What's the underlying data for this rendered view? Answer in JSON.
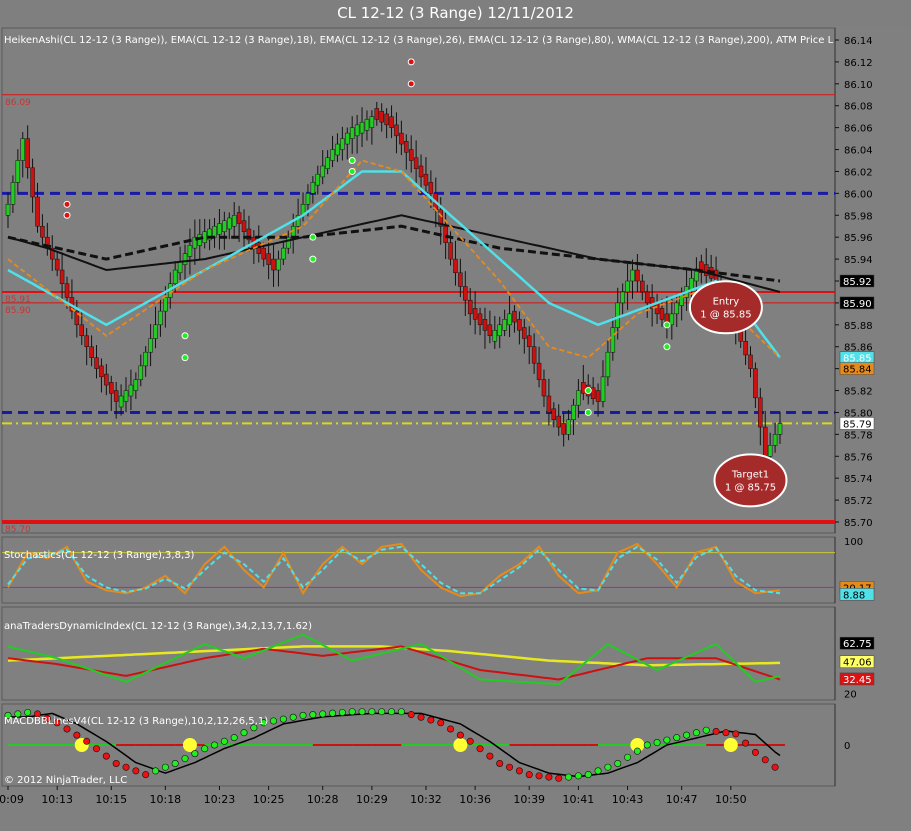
{
  "chart_title": "CL 12-12 (3 Range)  12/11/2012",
  "copyright": "© 2012 NinjaTrader, LLC",
  "colors": {
    "background": "#808080",
    "bull_candle": "#22cc22",
    "bear_candle": "#cc1111",
    "ema18": "#e88a1a",
    "ema26": "#4fe0e8",
    "ema80": "#111111",
    "wma200": "#111111",
    "blue_level": "#1a1aa8",
    "red_level": "#dd1111",
    "yellow_level": "#d8d820"
  },
  "chart_data": [
    {
      "type": "candlestick",
      "name": "price",
      "legend": "HeikenAshi(CL 12-12 (3 Range)), EMA(CL 12-12 (3 Range),18), EMA(CL 12-12 (3 Range),26), EMA(CL 12-12 (3 Range),80), WMA(CL 12-12 (3 Range),200), ATM Price L",
      "ylim": [
        85.69,
        86.15
      ],
      "y_ticks": [
        "86.14",
        "86.12",
        "86.10",
        "86.08",
        "86.06",
        "86.04",
        "86.02",
        "86.00",
        "85.98",
        "85.96",
        "85.94",
        "85.92",
        "85.90",
        "85.88",
        "85.86",
        "85.84",
        "85.82",
        "85.80",
        "85.78",
        "85.76",
        "85.74",
        "85.72",
        "85.70"
      ],
      "x_ticks": [
        "10:09",
        "10:13",
        "10:15",
        "10:18",
        "10:23",
        "10:25",
        "10:28",
        "10:29",
        "10:32",
        "10:36",
        "10:39",
        "10:41",
        "10:43",
        "10:47",
        "10:50"
      ],
      "close_keypoints": [
        [
          0,
          85.99
        ],
        [
          3,
          86.05
        ],
        [
          6,
          85.97
        ],
        [
          10,
          85.93
        ],
        [
          14,
          85.88
        ],
        [
          18,
          85.84
        ],
        [
          22,
          85.81
        ],
        [
          26,
          85.83
        ],
        [
          30,
          85.88
        ],
        [
          34,
          85.93
        ],
        [
          38,
          85.96
        ],
        [
          42,
          85.97
        ],
        [
          46,
          85.98
        ],
        [
          50,
          85.95
        ],
        [
          54,
          85.93
        ],
        [
          58,
          85.97
        ],
        [
          62,
          86.01
        ],
        [
          66,
          86.04
        ],
        [
          70,
          86.06
        ],
        [
          74,
          86.07
        ],
        [
          78,
          86.06
        ],
        [
          82,
          86.03
        ],
        [
          86,
          86.0
        ],
        [
          90,
          85.94
        ],
        [
          94,
          85.89
        ],
        [
          98,
          85.87
        ],
        [
          102,
          85.89
        ],
        [
          106,
          85.86
        ],
        [
          110,
          85.8
        ],
        [
          113,
          85.78
        ],
        [
          116,
          85.82
        ],
        [
          120,
          85.81
        ],
        [
          124,
          85.9
        ],
        [
          127,
          85.93
        ],
        [
          130,
          85.9
        ],
        [
          134,
          85.88
        ],
        [
          136,
          85.9
        ],
        [
          140,
          85.93
        ],
        [
          144,
          85.92
        ],
        [
          147,
          85.89
        ],
        [
          151,
          85.84
        ],
        [
          154,
          85.76
        ],
        [
          157,
          85.79
        ]
      ],
      "ema18": [
        [
          0,
          85.94
        ],
        [
          20,
          85.87
        ],
        [
          40,
          85.93
        ],
        [
          60,
          85.97
        ],
        [
          72,
          86.03
        ],
        [
          80,
          86.02
        ],
        [
          90,
          85.97
        ],
        [
          100,
          85.92
        ],
        [
          110,
          85.86
        ],
        [
          118,
          85.85
        ],
        [
          128,
          85.89
        ],
        [
          140,
          85.91
        ],
        [
          150,
          85.88
        ],
        [
          157,
          85.85
        ]
      ],
      "ema26": [
        [
          0,
          85.93
        ],
        [
          20,
          85.88
        ],
        [
          40,
          85.93
        ],
        [
          60,
          85.98
        ],
        [
          72,
          86.02
        ],
        [
          80,
          86.02
        ],
        [
          90,
          85.98
        ],
        [
          100,
          85.94
        ],
        [
          110,
          85.9
        ],
        [
          120,
          85.88
        ],
        [
          132,
          85.9
        ],
        [
          144,
          85.92
        ],
        [
          152,
          85.88
        ],
        [
          157,
          85.85
        ]
      ],
      "ema80": [
        [
          0,
          85.96
        ],
        [
          20,
          85.94
        ],
        [
          40,
          85.96
        ],
        [
          60,
          85.96
        ],
        [
          80,
          85.97
        ],
        [
          90,
          85.96
        ],
        [
          100,
          85.95
        ],
        [
          120,
          85.94
        ],
        [
          140,
          85.93
        ],
        [
          157,
          85.92
        ]
      ],
      "wma200": [
        [
          0,
          85.96
        ],
        [
          8,
          85.95
        ],
        [
          20,
          85.93
        ],
        [
          40,
          85.94
        ],
        [
          60,
          85.96
        ],
        [
          80,
          85.98
        ],
        [
          90,
          85.97
        ],
        [
          100,
          85.96
        ],
        [
          120,
          85.94
        ],
        [
          140,
          85.93
        ],
        [
          157,
          85.91
        ]
      ],
      "lines": [
        {
          "y": 86.09,
          "color": "#dd1111",
          "width": 1,
          "label": "86.09"
        },
        {
          "y": 86.0,
          "color": "#1a1aa8",
          "width": 3,
          "dash": "10,6"
        },
        {
          "y": 85.91,
          "color": "#dd1111",
          "width": 2,
          "label": "85.91"
        },
        {
          "y": 85.9,
          "color": "#dd1111",
          "width": 1,
          "label": "85.90"
        },
        {
          "y": 85.8,
          "color": "#1a1aa8",
          "width": 3,
          "dash": "10,6"
        },
        {
          "y": 85.79,
          "color": "#d8d820",
          "width": 2,
          "dash": "10,4,2,4"
        },
        {
          "y": 85.7,
          "color": "#dd1111",
          "width": 4,
          "label": "85.70"
        }
      ],
      "price_tags": [
        {
          "y": 85.92,
          "text": "85.92",
          "bg": "#000000",
          "fg": "#ffffff"
        },
        {
          "y": 85.9,
          "text": "85.90",
          "bg": "#000000",
          "fg": "#ffffff"
        },
        {
          "y": 85.85,
          "text": "85.85",
          "bg": "#4fe0e8",
          "fg": "#ffffff"
        },
        {
          "y": 85.84,
          "text": "85.84",
          "bg": "#e88a1a",
          "fg": "#000000"
        },
        {
          "y": 85.79,
          "text": "85.79",
          "bg": "#ffffff",
          "fg": "#000000"
        }
      ],
      "red_dots": [
        [
          12,
          85.99
        ],
        [
          12,
          85.98
        ],
        [
          82,
          86.12
        ],
        [
          82,
          86.1
        ]
      ],
      "green_dots": [
        [
          36,
          85.87
        ],
        [
          36,
          85.85
        ],
        [
          70,
          86.03
        ],
        [
          70,
          86.02
        ],
        [
          62,
          85.96
        ],
        [
          62,
          85.94
        ],
        [
          118,
          85.82
        ],
        [
          118,
          85.8
        ],
        [
          134,
          85.88
        ],
        [
          134,
          85.86
        ]
      ],
      "annotations": [
        {
          "x": 146,
          "y": 85.896,
          "line1": "Entry",
          "line2": "1 @ 85.85"
        },
        {
          "x": 151,
          "y": 85.738,
          "line1": "Target1",
          "line2": "1 @ 85.75"
        }
      ]
    },
    {
      "type": "line",
      "name": "stochastics",
      "legend": "Stochastics(CL 12-12 (3 Range),3,8,3)",
      "ylim": [
        0,
        100
      ],
      "y_ticks": [
        "100"
      ],
      "upper_level": 80,
      "lower_level": 20,
      "tags": [
        {
          "value": 20.17,
          "text": "20.17",
          "bg": "#e88a1a"
        },
        {
          "value": 8,
          "text": "8.88",
          "bg": "#4fe0e8"
        }
      ],
      "k_keypoints": [
        [
          0,
          20
        ],
        [
          4,
          80
        ],
        [
          8,
          70
        ],
        [
          12,
          90
        ],
        [
          16,
          30
        ],
        [
          20,
          15
        ],
        [
          24,
          10
        ],
        [
          28,
          20
        ],
        [
          32,
          40
        ],
        [
          36,
          10
        ],
        [
          40,
          60
        ],
        [
          44,
          90
        ],
        [
          48,
          50
        ],
        [
          52,
          20
        ],
        [
          56,
          80
        ],
        [
          60,
          10
        ],
        [
          64,
          60
        ],
        [
          68,
          90
        ],
        [
          72,
          60
        ],
        [
          76,
          90
        ],
        [
          80,
          95
        ],
        [
          84,
          50
        ],
        [
          88,
          20
        ],
        [
          92,
          5
        ],
        [
          96,
          10
        ],
        [
          100,
          40
        ],
        [
          104,
          60
        ],
        [
          108,
          90
        ],
        [
          112,
          40
        ],
        [
          116,
          10
        ],
        [
          120,
          15
        ],
        [
          124,
          80
        ],
        [
          128,
          95
        ],
        [
          132,
          60
        ],
        [
          136,
          20
        ],
        [
          140,
          80
        ],
        [
          144,
          90
        ],
        [
          148,
          30
        ],
        [
          152,
          10
        ],
        [
          157,
          15
        ]
      ],
      "d_keypoints": [
        [
          0,
          25
        ],
        [
          4,
          70
        ],
        [
          8,
          75
        ],
        [
          12,
          85
        ],
        [
          16,
          40
        ],
        [
          20,
          20
        ],
        [
          24,
          12
        ],
        [
          28,
          18
        ],
        [
          32,
          35
        ],
        [
          36,
          18
        ],
        [
          40,
          50
        ],
        [
          44,
          80
        ],
        [
          48,
          60
        ],
        [
          52,
          30
        ],
        [
          56,
          70
        ],
        [
          60,
          20
        ],
        [
          64,
          50
        ],
        [
          68,
          85
        ],
        [
          72,
          65
        ],
        [
          76,
          85
        ],
        [
          80,
          90
        ],
        [
          84,
          60
        ],
        [
          88,
          28
        ],
        [
          92,
          10
        ],
        [
          96,
          10
        ],
        [
          100,
          32
        ],
        [
          104,
          55
        ],
        [
          108,
          85
        ],
        [
          112,
          50
        ],
        [
          116,
          18
        ],
        [
          120,
          15
        ],
        [
          124,
          70
        ],
        [
          128,
          90
        ],
        [
          132,
          68
        ],
        [
          136,
          28
        ],
        [
          140,
          72
        ],
        [
          144,
          88
        ],
        [
          148,
          40
        ],
        [
          152,
          15
        ],
        [
          157,
          10
        ]
      ]
    },
    {
      "type": "line",
      "name": "traders-dynamic-index",
      "legend": "anaTradersDynamicIndex(CL 12-12 (3 Range),34,2,13,7,1.62)",
      "ylim": [
        18,
        90
      ],
      "y_ticks": [
        "20"
      ],
      "tags": [
        {
          "value": 62.75,
          "text": "62.75",
          "bg": "#000000"
        },
        {
          "value": 47.06,
          "text": "47.06",
          "bg": "#ffff66"
        },
        {
          "value": 32.45,
          "text": "32.45",
          "bg": "#dd1111"
        }
      ],
      "yellow": [
        [
          0,
          48
        ],
        [
          20,
          52
        ],
        [
          40,
          56
        ],
        [
          60,
          60
        ],
        [
          76,
          60
        ],
        [
          90,
          56
        ],
        [
          110,
          48
        ],
        [
          130,
          44
        ],
        [
          157,
          46
        ]
      ],
      "red": [
        [
          0,
          50
        ],
        [
          10,
          45
        ],
        [
          24,
          35
        ],
        [
          40,
          50
        ],
        [
          52,
          58
        ],
        [
          64,
          52
        ],
        [
          80,
          60
        ],
        [
          96,
          40
        ],
        [
          112,
          32
        ],
        [
          130,
          50
        ],
        [
          144,
          50
        ],
        [
          157,
          32
        ]
      ],
      "green": [
        [
          0,
          60
        ],
        [
          10,
          50
        ],
        [
          24,
          30
        ],
        [
          40,
          62
        ],
        [
          48,
          50
        ],
        [
          60,
          70
        ],
        [
          70,
          48
        ],
        [
          84,
          62
        ],
        [
          96,
          32
        ],
        [
          112,
          28
        ],
        [
          122,
          62
        ],
        [
          132,
          40
        ],
        [
          144,
          62
        ],
        [
          152,
          30
        ],
        [
          157,
          35
        ]
      ]
    },
    {
      "type": "scatter",
      "name": "macd-bb-lines",
      "legend": "MACDBBLinesV4(CL 12-12 (3 Range),10,2,12,26,5,1)",
      "ylim": [
        -1,
        1
      ],
      "y_ticks": [
        "0"
      ],
      "dots": [
        [
          0,
          0.8
        ],
        [
          5,
          0.9
        ],
        [
          10,
          0.6
        ],
        [
          16,
          0.1
        ],
        [
          22,
          -0.5
        ],
        [
          28,
          -0.8
        ],
        [
          34,
          -0.5
        ],
        [
          40,
          -0.1
        ],
        [
          46,
          0.2
        ],
        [
          52,
          0.6
        ],
        [
          60,
          0.8
        ],
        [
          70,
          0.9
        ],
        [
          80,
          0.9
        ],
        [
          88,
          0.6
        ],
        [
          94,
          0.1
        ],
        [
          100,
          -0.5
        ],
        [
          106,
          -0.8
        ],
        [
          112,
          -0.9
        ],
        [
          118,
          -0.8
        ],
        [
          124,
          -0.5
        ],
        [
          130,
          0.0
        ],
        [
          136,
          0.2
        ],
        [
          142,
          0.4
        ],
        [
          148,
          0.3
        ],
        [
          152,
          -0.2
        ],
        [
          157,
          -0.7
        ]
      ],
      "yellow_markers": [
        15,
        37,
        92,
        128,
        147
      ]
    }
  ]
}
